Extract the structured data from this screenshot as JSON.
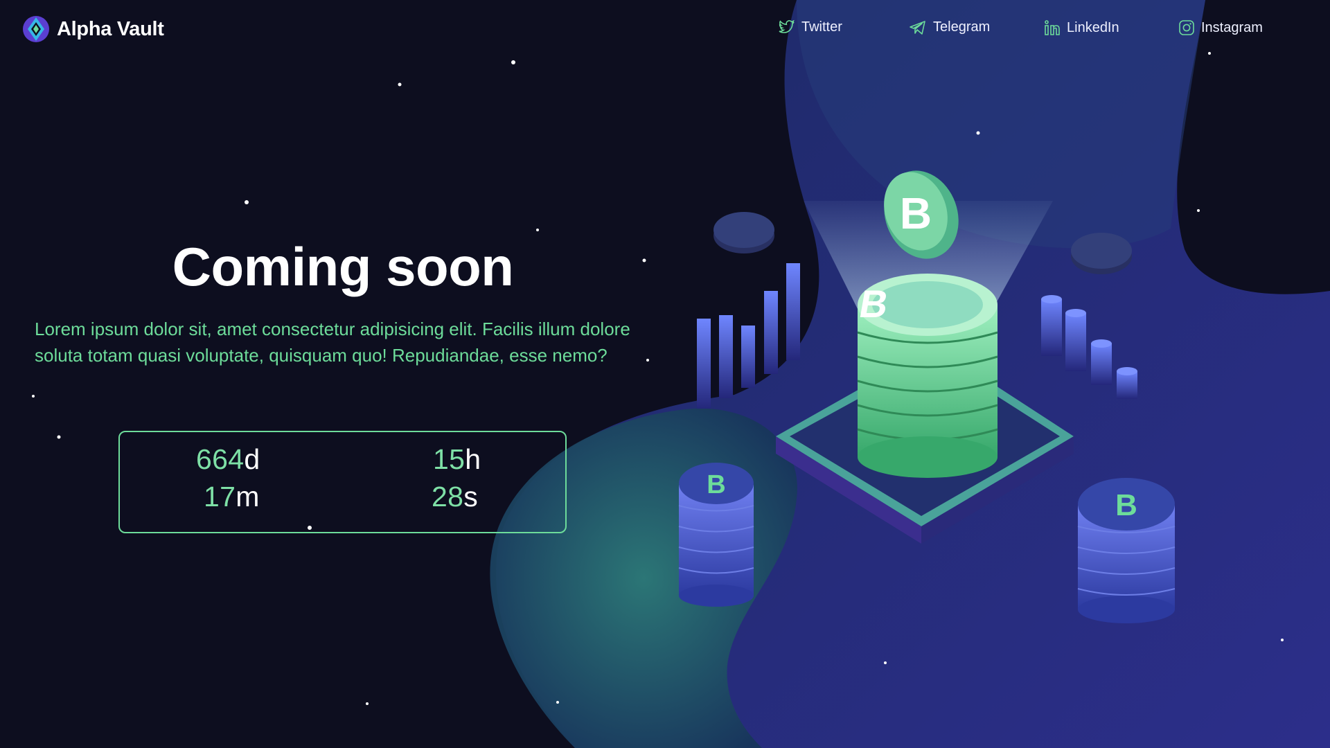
{
  "header": {
    "logo_name": "Alpha Vault",
    "nav": [
      {
        "label": "Twitter",
        "icon": "twitter-icon"
      },
      {
        "label": "Telegram",
        "icon": "telegram-icon"
      },
      {
        "label": "LinkedIn",
        "icon": "linkedin-icon"
      },
      {
        "label": "Instagram",
        "icon": "instagram-icon"
      }
    ]
  },
  "hero": {
    "title": "Coming soon",
    "text": "Lorem ipsum dolor sit, amet consectetur adipisicing elit. Facilis illum dolore soluta totam quasi voluptate, quisquam quo! Repudiandae, esse nemo?"
  },
  "countdown": {
    "days": {
      "value": "664",
      "unit": "d"
    },
    "hours": {
      "value": "15",
      "unit": "h"
    },
    "minutes": {
      "value": "17",
      "unit": "m"
    },
    "seconds": {
      "value": "28",
      "unit": "s"
    }
  },
  "colors": {
    "background": "#0d0e1f",
    "accent_green": "#6ddc9a",
    "accent_blue": "#3e4bb8",
    "accent_teal": "#1f5f6b"
  }
}
